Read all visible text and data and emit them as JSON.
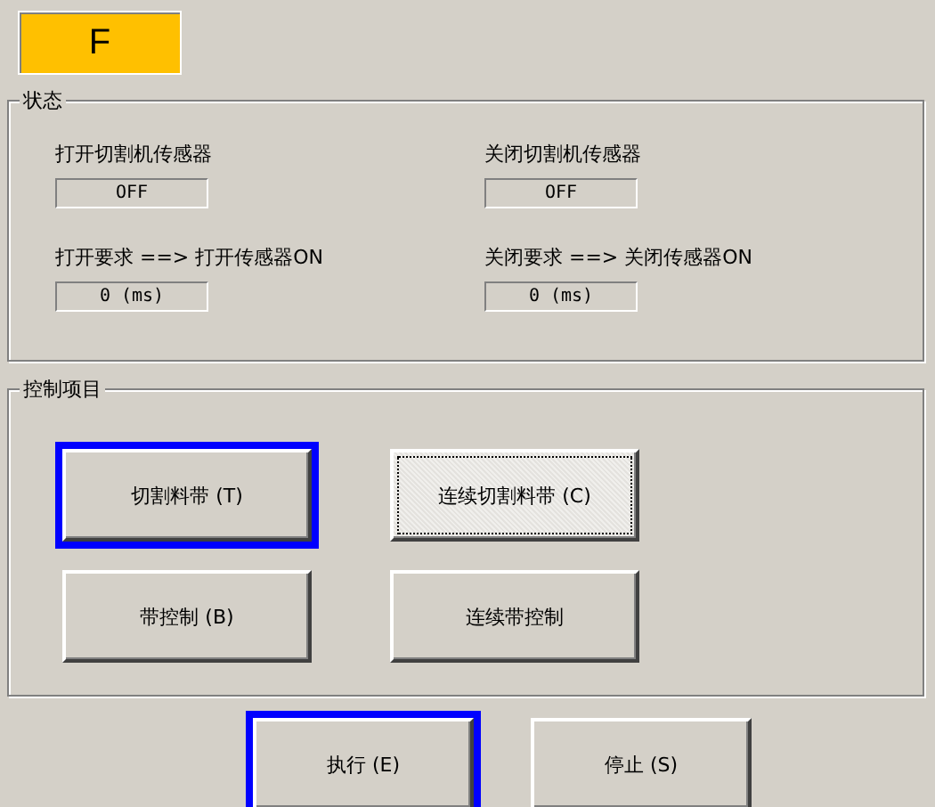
{
  "mode_indicator": {
    "label": "F"
  },
  "status": {
    "title": "状态",
    "fields": [
      {
        "label": "打开切割机传感器",
        "value": "OFF"
      },
      {
        "label": "关闭切割机传感器",
        "value": "OFF"
      },
      {
        "label": "打开要求 ==> 打开传感器ON",
        "value": "0 (ms)"
      },
      {
        "label": "关闭要求 ==> 关闭传感器ON",
        "value": "0 (ms)"
      }
    ]
  },
  "control": {
    "title": "控制项目",
    "buttons": [
      {
        "label": "切割料带 (T)",
        "highlighted": true,
        "pressed": false
      },
      {
        "label": "连续切割料带 (C)",
        "highlighted": false,
        "pressed": true
      },
      {
        "label": "带控制 (B)",
        "highlighted": false,
        "pressed": false
      },
      {
        "label": "连续带控制",
        "highlighted": false,
        "pressed": false
      }
    ]
  },
  "actions": [
    {
      "label": "执行 (E)",
      "highlighted": true,
      "pressed": false
    },
    {
      "label": "停止 (S)",
      "highlighted": false,
      "pressed": false
    }
  ]
}
